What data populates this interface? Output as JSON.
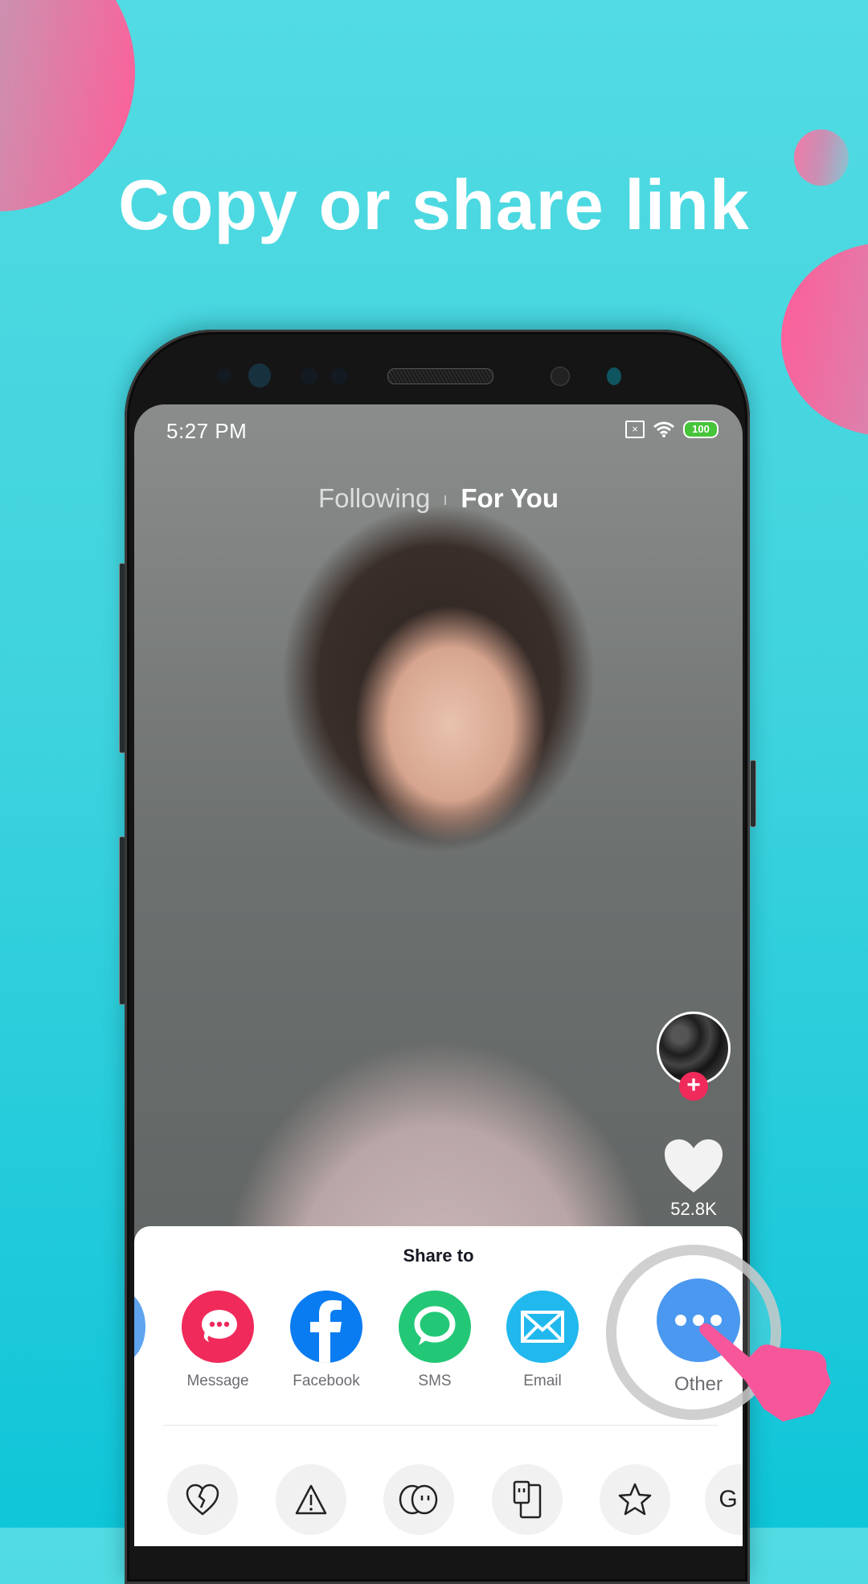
{
  "headline": "Copy or share link",
  "colors": {
    "background": "#3fd3de",
    "accent_pink": "#ff5c98",
    "message_red": "#f02a5a",
    "facebook_blue": "#0a7cf2",
    "sms_green": "#23c876",
    "email_cyan": "#21b8ee",
    "other_blue": "#4a98ef",
    "battery_green": "#46c43a"
  },
  "status_bar": {
    "time": "5:27  PM",
    "sim_icon": "no-sim-icon",
    "wifi_icon": "wifi-icon",
    "battery_level": "100"
  },
  "feed_tabs": {
    "following": "Following",
    "for_you": "For You",
    "active": "For You"
  },
  "side_actions": {
    "avatar_icon": "creator-avatar",
    "follow_icon": "plus-icon",
    "like_icon": "heart-icon",
    "like_count": "52.8K"
  },
  "share_sheet": {
    "title": "Share to",
    "targets": [
      {
        "label": "Message",
        "icon": "message-bubble-icon"
      },
      {
        "label": "Facebook",
        "icon": "facebook-icon"
      },
      {
        "label": "SMS",
        "icon": "chat-bubble-icon"
      },
      {
        "label": "Email",
        "icon": "envelope-icon"
      },
      {
        "label": "Other",
        "icon": "more-dots-icon"
      }
    ],
    "actions": [
      {
        "icon": "broken-heart-icon"
      },
      {
        "icon": "warning-icon"
      },
      {
        "icon": "duet-icon"
      },
      {
        "icon": "react-icon"
      },
      {
        "icon": "star-icon"
      },
      {
        "icon": "gif-icon",
        "text": "G"
      }
    ]
  }
}
